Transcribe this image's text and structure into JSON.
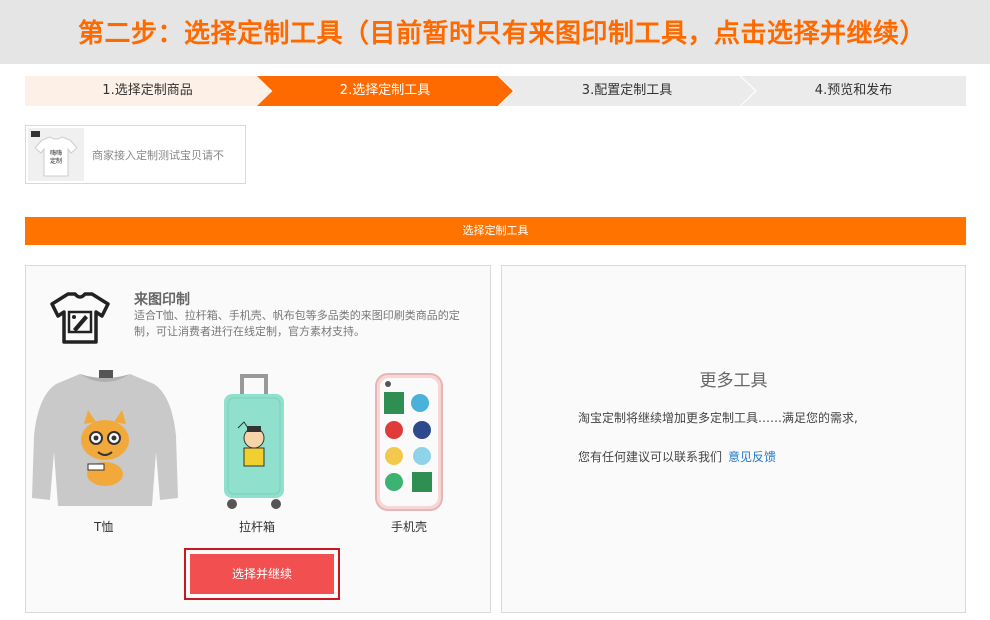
{
  "banner": {
    "title": "第二步：选择定制工具（目前暂时只有来图印制工具，点击选择并继续）"
  },
  "steps": [
    {
      "label": "1.选择定制商品"
    },
    {
      "label": "2.选择定制工具"
    },
    {
      "label": "3.配置定制工具"
    },
    {
      "label": "4.预览和发布"
    }
  ],
  "product": {
    "name": "商家接入定制测试宝贝请不",
    "thumb_text": "嗨嗨定制"
  },
  "section": {
    "title": "选择定制工具"
  },
  "tool": {
    "title": "来图印制",
    "description": "适合T恤、拉杆箱、手机壳、帆布包等多品类的来图印刷类商品的定制，可让消费者进行在线定制，官方素材支持。",
    "samples": [
      {
        "label": "T恤"
      },
      {
        "label": "拉杆箱"
      },
      {
        "label": "手机壳"
      }
    ],
    "button": "选择并继续"
  },
  "more": {
    "title": "更多工具",
    "description": "淘宝定制将继续增加更多定制工具……满足您的需求,",
    "contact": "您有任何建议可以联系我们",
    "feedback": "意见反馈"
  },
  "colors": {
    "accent": "#ff6a00",
    "cta": "#f25050",
    "cta_border": "#c8181e",
    "link": "#1f78c8"
  }
}
